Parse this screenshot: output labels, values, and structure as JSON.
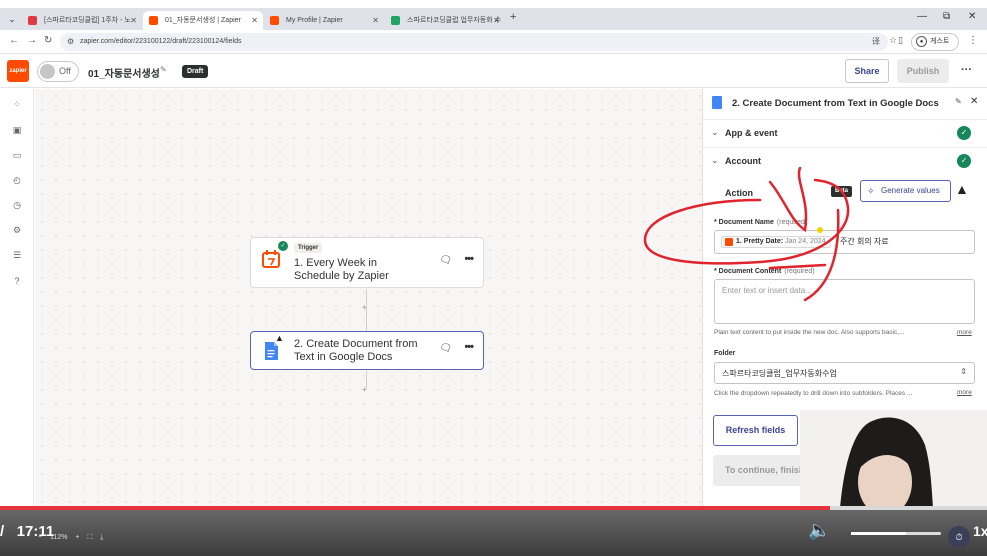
{
  "browser": {
    "tabs": [
      {
        "label": "[스파르타코딩클럽] 1주차 - 노",
        "active": false,
        "color": "#e23a45"
      },
      {
        "label": "01_자동문서생성 | Zapier",
        "active": true,
        "color": "#ff4a00"
      },
      {
        "label": "My Profile | Zapier",
        "active": false,
        "color": "#ff4a00"
      },
      {
        "label": "스파르타코딩클럽 업무자동화 수",
        "active": false,
        "color": "#1fa463"
      }
    ],
    "url": "zapier.com/editor/223100122/draft/223100124/fields",
    "profile_label": "게스트"
  },
  "zap": {
    "status_toggle": "Off",
    "name": "01_자동문서생성",
    "draft_badge": "Draft",
    "share_label": "Share",
    "publish_label": "Publish"
  },
  "canvas": {
    "steps": [
      {
        "badge": "Trigger",
        "title": "1. Every Week in Schedule by Zapier"
      },
      {
        "title": "2. Create Document from Text in Google Docs"
      }
    ]
  },
  "panel": {
    "title": "2. Create Document from Text in Google Docs",
    "sections": [
      {
        "label": "App & event"
      },
      {
        "label": "Account"
      }
    ],
    "action_label": "Action",
    "beta_badge": "Beta",
    "generate_label": "Generate values",
    "fields": {
      "doc_name": {
        "label": "* Document Name",
        "required": "(required)",
        "pill_label": "1. Pretty Date:",
        "pill_value": "Jan 24, 2024",
        "suffix_text": "주간 회의 자료"
      },
      "doc_content": {
        "label": "* Document Content",
        "required": "(required)",
        "placeholder": "Enter text or insert data...",
        "hint": "Plain text content to put inside the new doc. Also supports basic,..."
      },
      "folder": {
        "label": "Folder",
        "value": "스파르타코딩클럽_업무자동화수업",
        "hint": "Click the dropdown repeatedly to drill down into subfolders. Places ..."
      }
    },
    "more_label": "more",
    "refresh_label": "Refresh fields",
    "continue_label": "To continue, finish required fields"
  },
  "player": {
    "time": "/   17:11",
    "speed": "1x",
    "zoom": "112%"
  },
  "colors": {
    "zapier_orange": "#ff4a00",
    "accent_blue": "#3d4592",
    "success_green": "#16875a",
    "annotation_red": "#e0242d"
  }
}
